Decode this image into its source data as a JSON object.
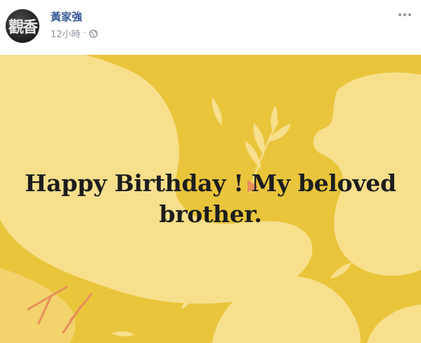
{
  "post": {
    "author": "黃家強",
    "timestamp": "12小時",
    "separator": "·",
    "privacy_icon": "globe-icon",
    "avatar_text": "觀香",
    "more_icon": "more-options-icon"
  },
  "card": {
    "line1": "Happy Birthday ! My beloved",
    "line2": "brother.",
    "background_color": "#e9c53c",
    "accent_color": "#f7df8c"
  }
}
